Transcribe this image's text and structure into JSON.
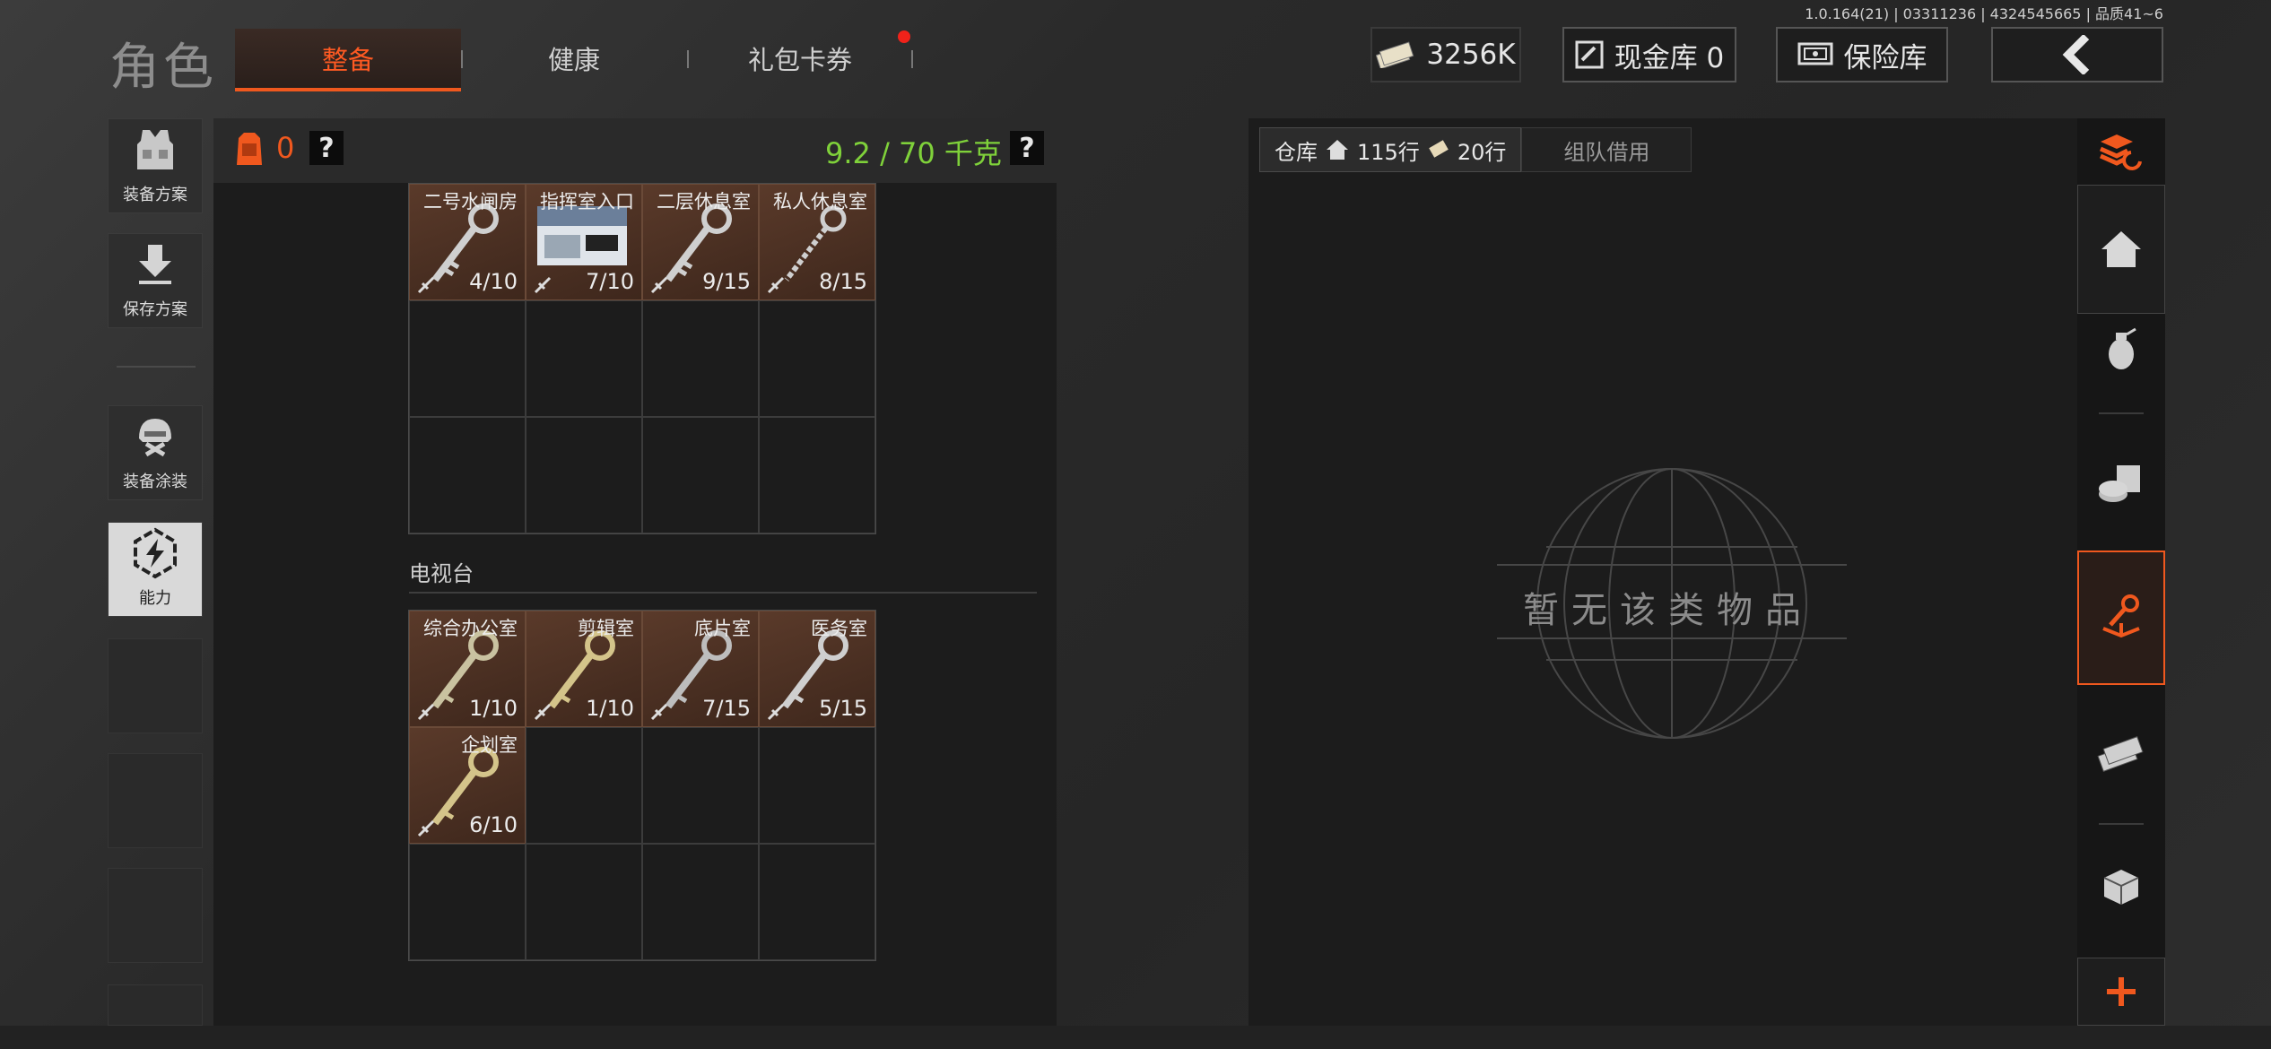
{
  "version": "1.0.164(21) | 03311236 | 4324545665 | 品质41~6",
  "page_title": "角色",
  "tabs": [
    {
      "label": "整备",
      "active": true
    },
    {
      "label": "健康",
      "active": false
    },
    {
      "label": "礼包卡券",
      "active": false,
      "badge": true
    }
  ],
  "currency": {
    "money": "3256K",
    "cash_bank": "现金库 0",
    "safe": "保险库"
  },
  "sidebar": [
    {
      "label": "装备方案",
      "icon": "vest-icon"
    },
    {
      "label": "保存方案",
      "icon": "download-icon"
    },
    {
      "label": "装备涂装",
      "icon": "helmet-icon"
    },
    {
      "label": "能力",
      "icon": "ability-icon",
      "active": true
    }
  ],
  "loadout": {
    "bag_count": "0",
    "weight": "9.2 / 70 千克",
    "help": "?"
  },
  "section1_items": [
    {
      "name": "二号水闸房",
      "count": "4/10"
    },
    {
      "name": "指挥室入口",
      "count": "7/10"
    },
    {
      "name": "二层休息室",
      "count": "9/15"
    },
    {
      "name": "私人休息室",
      "count": "8/15"
    }
  ],
  "section_tv": {
    "title": "电视台",
    "items": [
      {
        "name": "综合办公室",
        "count": "1/10"
      },
      {
        "name": "剪辑室",
        "count": "1/10"
      },
      {
        "name": "底片室",
        "count": "7/15"
      },
      {
        "name": "医务室",
        "count": "5/15"
      },
      {
        "name": "企划室",
        "count": "6/10"
      }
    ]
  },
  "warehouse": {
    "tab_main": "仓库",
    "rows_home": "115行",
    "rows_ticket": "20行",
    "tab_team": "组队借用",
    "empty": "暂无该类物品"
  },
  "rail_icons": [
    "refresh-stack-icon",
    "home-icon",
    "grenade-icon",
    "supplies-icon",
    "key-icon",
    "cash-icon",
    "box-icon",
    "plus-icon"
  ],
  "colors": {
    "accent": "#f0581e",
    "weight": "#7fd13a",
    "item_bg": "#4a3024"
  }
}
